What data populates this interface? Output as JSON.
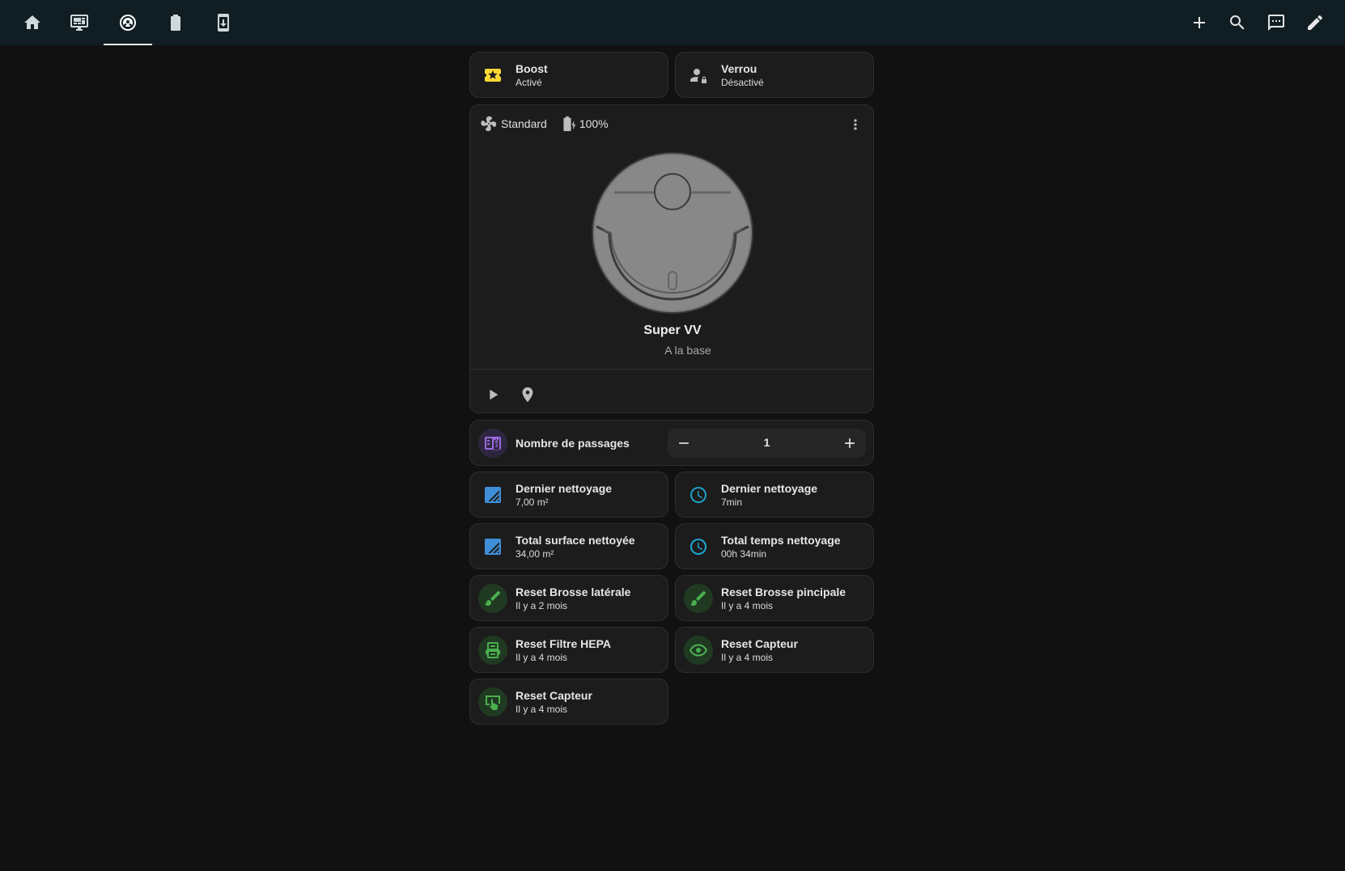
{
  "topbar": {
    "tabs": [
      {
        "icon": "home-icon"
      },
      {
        "icon": "monitor-dashboard-icon"
      },
      {
        "icon": "robot-vacuum-icon",
        "active": true
      },
      {
        "icon": "battery-icon"
      },
      {
        "icon": "tablet-download-icon"
      }
    ],
    "actions": [
      {
        "icon": "plus-icon"
      },
      {
        "icon": "search-icon"
      },
      {
        "icon": "assist-message-icon"
      },
      {
        "icon": "pencil-icon"
      }
    ]
  },
  "boost": {
    "title": "Boost",
    "state": "Activé",
    "icon": "ticket-icon",
    "color": "#fdd835"
  },
  "lock": {
    "title": "Verrou",
    "state": "Désactivé",
    "icon": "account-lock-icon",
    "color": "#bdbdbd"
  },
  "vacuum": {
    "fan_speed": "Standard",
    "battery": "100%",
    "name": "Super VV",
    "state": "A la base",
    "actions": [
      {
        "icon": "play-icon"
      },
      {
        "icon": "map-marker-icon"
      }
    ]
  },
  "passes": {
    "label": "Nombre de passages",
    "value": "1",
    "icon": "counter-icon",
    "color": "#9c6ade"
  },
  "tiles": [
    {
      "title": "Dernier nettoyage",
      "value": "7,00 m²",
      "icon": "texture-box-icon",
      "color": "#3f8fd8"
    },
    {
      "title": "Dernier nettoyage",
      "value": "7min",
      "icon": "timer-outline-icon",
      "color": "#1aa8d3"
    },
    {
      "title": "Total surface nettoyée",
      "value": "34,00 m²",
      "icon": "texture-box-icon",
      "color": "#3f8fd8"
    },
    {
      "title": "Total temps nettoyage",
      "value": "00h 34min",
      "icon": "timer-outline-icon",
      "color": "#1aa8d3"
    },
    {
      "title": "Reset Brosse latérale",
      "value": "Il y a 2 mois",
      "icon": "brush-icon",
      "color": "#4caf50"
    },
    {
      "title": "Reset Brosse pincipale",
      "value": "Il y a 4 mois",
      "icon": "brush-icon",
      "color": "#4caf50"
    },
    {
      "title": "Reset Filtre HEPA",
      "value": "Il y a 4 mois",
      "icon": "air-filter-icon",
      "color": "#4caf50"
    },
    {
      "title": "Reset Capteur",
      "value": "Il y a 4 mois",
      "icon": "eye-icon",
      "color": "#4caf50"
    },
    {
      "title": "Reset Capteur",
      "value": "Il y a 4 mois",
      "icon": "gesture-tap-icon",
      "color": "#4caf50"
    }
  ]
}
